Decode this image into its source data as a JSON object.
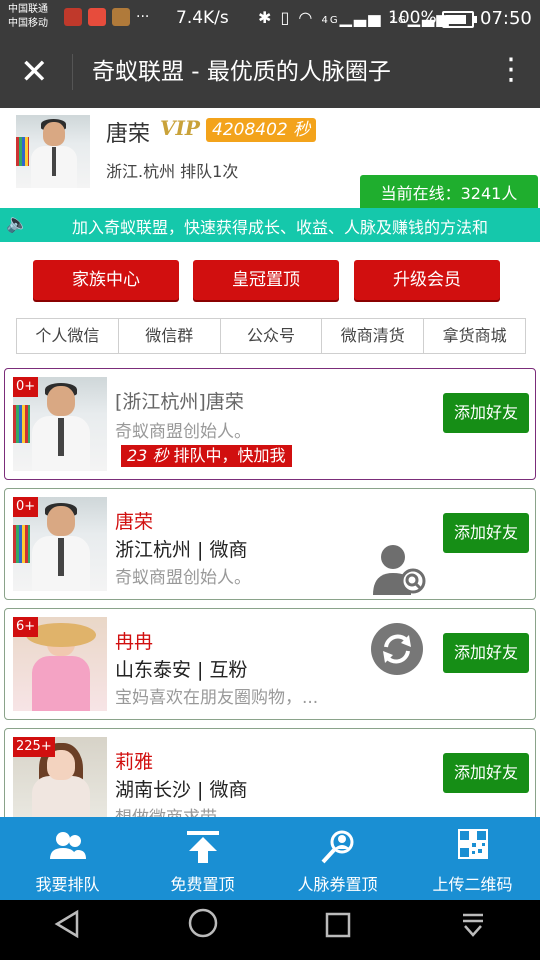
{
  "status_bar": {
    "carrier1": "中国联通",
    "carrier2": "中国移动",
    "speed": "7.4K/s",
    "battery": "100%",
    "battery_level": 1.0,
    "time": "07:50",
    "net1": "4G",
    "net2": "2G"
  },
  "title_bar": {
    "title": "奇蚁联盟 - 最优质的人脉圈子"
  },
  "profile": {
    "name": "唐荣",
    "vip": "VIP",
    "seconds": "4208402 秒",
    "location": "浙江.杭州  排队1次",
    "online": "当前在线：3241人"
  },
  "marquee": {
    "text": "加入奇蚁联盟，快速获得成长、收益、人脉及赚钱的方法和"
  },
  "buttons": {
    "family": "家族中心",
    "crown": "皇冠置顶",
    "upgrade": "升级会员"
  },
  "tabs": [
    "个人微信",
    "微信群",
    "公众号",
    "微商清货",
    "拿货商城"
  ],
  "cards": [
    {
      "badge": "0+",
      "line1": "[浙江杭州]唐荣",
      "line2": "奇蚁商盟创始人。",
      "queue_secs": "23 秒",
      "queue_text": " 排队中，快加我",
      "add": "添加好友"
    },
    {
      "badge": "0+",
      "line1": "唐荣",
      "line2": "浙江杭州 | 微商",
      "line3": "奇蚁商盟创始人。",
      "add": "添加好友"
    },
    {
      "badge": "6+",
      "line1": "冉冉",
      "line2": "山东泰安 | 互粉",
      "line3": "宝妈喜欢在朋友圈购物，...",
      "add": "添加好友"
    },
    {
      "badge": "225+",
      "line1": "莉雅",
      "line2": "湖南长沙 | 微商",
      "line3": "想做微商求带",
      "add": "添加好友"
    }
  ],
  "bottom_nav": [
    "我要排队",
    "免费置顶",
    "人脉券置顶",
    "上传二维码"
  ],
  "colors": {
    "titlebar": "#3b3b3b",
    "marquee": "#15c8ab",
    "red_button": "#d10f0f",
    "add_button": "#168e16",
    "bottom_nav": "#1a8fd3"
  }
}
